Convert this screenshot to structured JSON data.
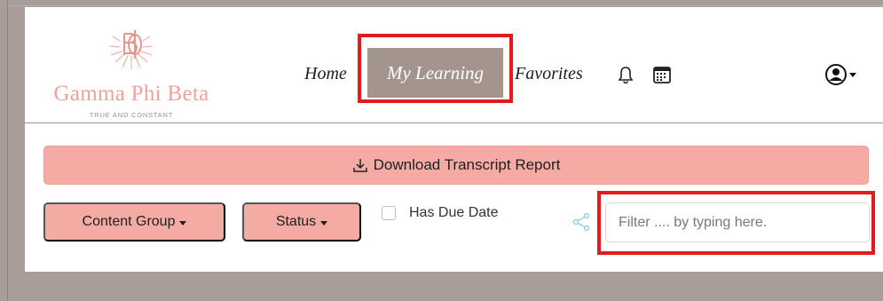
{
  "brand": {
    "name": "Gamma Phi Beta",
    "tagline": "TRUE AND CONSTANT",
    "colors": {
      "pink": "#f4aba4",
      "taupe": "#a3948e"
    }
  },
  "nav": {
    "items": [
      {
        "label": "Home"
      },
      {
        "label": "My Learning",
        "active": true
      },
      {
        "label": "Favorites"
      }
    ],
    "icons": [
      "bell-icon",
      "calendar-icon",
      "user-account-icon"
    ]
  },
  "actions": {
    "download_label": "Download Transcript Report",
    "content_group_label": "Content Group",
    "status_label": "Status",
    "due_label": "Has Due Date",
    "filter_placeholder": "Filter .... by typing here."
  }
}
